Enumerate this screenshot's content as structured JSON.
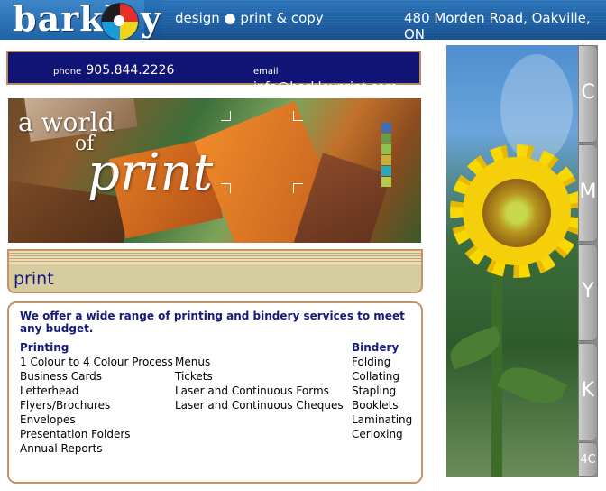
{
  "header": {
    "logo_text": "barkley",
    "tagline": "design ● print & copy",
    "address": "480 Morden Road, Oakville, ON"
  },
  "contact": {
    "phone_label": "phone",
    "phone": "905.844.2226",
    "email_label": "email",
    "email": "info@barkleyprint.com"
  },
  "hero": {
    "line1": "a world",
    "line2": "of",
    "line3": "print",
    "swatch_colors": [
      "#3c6fb4",
      "#6b9a46",
      "#8fbf4c",
      "#c3b240",
      "#2fa6b8",
      "#b9c94a"
    ]
  },
  "section": {
    "title": "print"
  },
  "services": {
    "intro": "We offer a wide range of printing and bindery services to meet any budget.",
    "printing_heading": "Printing",
    "printing_items": [
      "1 Colour to 4 Colour Process",
      "Business Cards",
      "Letterhead",
      "Flyers/Brochures",
      "Envelopes",
      "Presentation Folders",
      "Annual Reports"
    ],
    "other_items": [
      "Menus",
      "Tickets",
      "Laser and Continuous Forms",
      "Laser and Continuous Cheques"
    ],
    "bindery_heading": "Bindery",
    "bindery_items": [
      "Folding",
      "Collating",
      "Stapling",
      "Booklets",
      "Laminating",
      "Cerloxing"
    ]
  },
  "side_tabs": [
    "C",
    "M",
    "Y",
    "K",
    "4C"
  ]
}
